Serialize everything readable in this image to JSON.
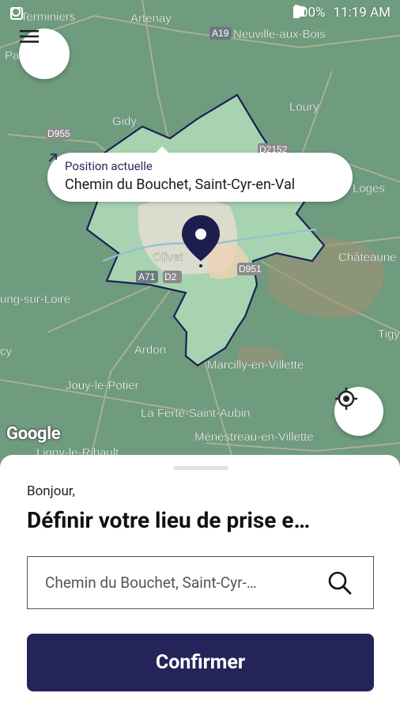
{
  "status_bar": {
    "battery": "100%",
    "time": "11:19 AM"
  },
  "map": {
    "places": [
      {
        "name": "Artenay"
      },
      {
        "name": "Neuville-aux-Bois"
      },
      {
        "name": "Gidy"
      },
      {
        "name": "Loury"
      },
      {
        "name": "Olivet"
      },
      {
        "name": "Châteauneuf"
      },
      {
        "name": "Meung-sur-Loire"
      },
      {
        "name": "Ardon"
      },
      {
        "name": "Marcilly-en-Villette"
      },
      {
        "name": "Tigy"
      },
      {
        "name": "Jouy-le-Potier"
      },
      {
        "name": "La Ferté-Saint-Aubin"
      },
      {
        "name": "Ménestreau-en-Villette"
      },
      {
        "name": "Ligny-le-Ribault"
      },
      {
        "name": "Loges"
      },
      {
        "name": "Terminiers"
      }
    ],
    "roads": [
      "A19",
      "D955",
      "D2152",
      "A71",
      "D951",
      "D2"
    ],
    "attribution": "Google"
  },
  "bubble": {
    "label": "Position actuelle",
    "address": "Chemin du Bouchet, Saint-Cyr-en-Val"
  },
  "sheet": {
    "greeting": "Bonjour,",
    "title": "Définir votre lieu de prise e…",
    "search_value": "Chemin du Bouchet, Saint-Cyr-…",
    "confirm_label": "Confirmer"
  },
  "colors": {
    "primary": "#24245a",
    "map_bg": "#6f9b7e",
    "zone_fill": "#a8d3b0",
    "zone_border": "#1c2154"
  }
}
